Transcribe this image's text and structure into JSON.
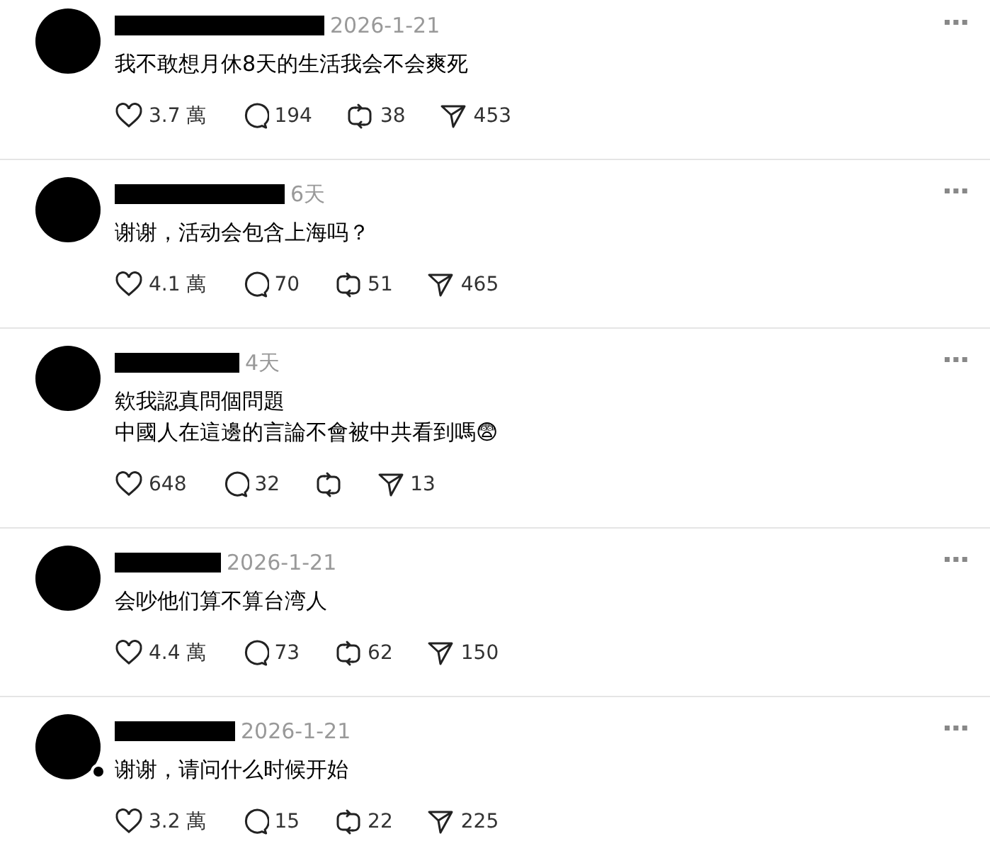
{
  "replies": [
    {
      "author_redacted": true,
      "avatar_badge": false,
      "time": "2026-1-21",
      "text": "我不敢想月休8天的生活我会不会爽死",
      "actions": [
        {
          "kind": "like",
          "count": "3.7 萬"
        },
        {
          "kind": "comment",
          "count": "194"
        },
        {
          "kind": "repost",
          "count": "38"
        },
        {
          "kind": "share",
          "count": "453"
        }
      ]
    },
    {
      "author_redacted": true,
      "avatar_badge": false,
      "time": "6天",
      "text": "谢谢，活动会包含上海吗？",
      "actions": [
        {
          "kind": "like",
          "count": "4.1 萬"
        },
        {
          "kind": "comment",
          "count": "70"
        },
        {
          "kind": "repost",
          "count": "51"
        },
        {
          "kind": "share",
          "count": "465"
        }
      ]
    },
    {
      "author_redacted": true,
      "avatar_badge": false,
      "time": "4天",
      "text": "欸我認真問個問題",
      "text_2": "中國人在這邊的言論不會被中共看到嗎😨",
      "actions": [
        {
          "kind": "like",
          "count": "648"
        },
        {
          "kind": "comment",
          "count": "32"
        },
        {
          "kind": "repost"
        },
        {
          "kind": "share",
          "count": "13"
        }
      ]
    },
    {
      "author_redacted": true,
      "avatar_badge": false,
      "time": "2026-1-21",
      "text": "会吵他们算不算台湾人",
      "actions": [
        {
          "kind": "like",
          "count": "4.4 萬"
        },
        {
          "kind": "comment",
          "count": "73"
        },
        {
          "kind": "repost",
          "count": "62"
        },
        {
          "kind": "share",
          "count": "150"
        }
      ]
    },
    {
      "author_redacted": true,
      "avatar_badge": true,
      "time": "2026-1-21",
      "text": "谢谢，请问什么时候开始",
      "actions": [
        {
          "kind": "like",
          "count": "3.2 萬"
        },
        {
          "kind": "comment",
          "count": "15"
        },
        {
          "kind": "repost",
          "count": "22"
        },
        {
          "kind": "share",
          "count": "225"
        }
      ]
    }
  ]
}
